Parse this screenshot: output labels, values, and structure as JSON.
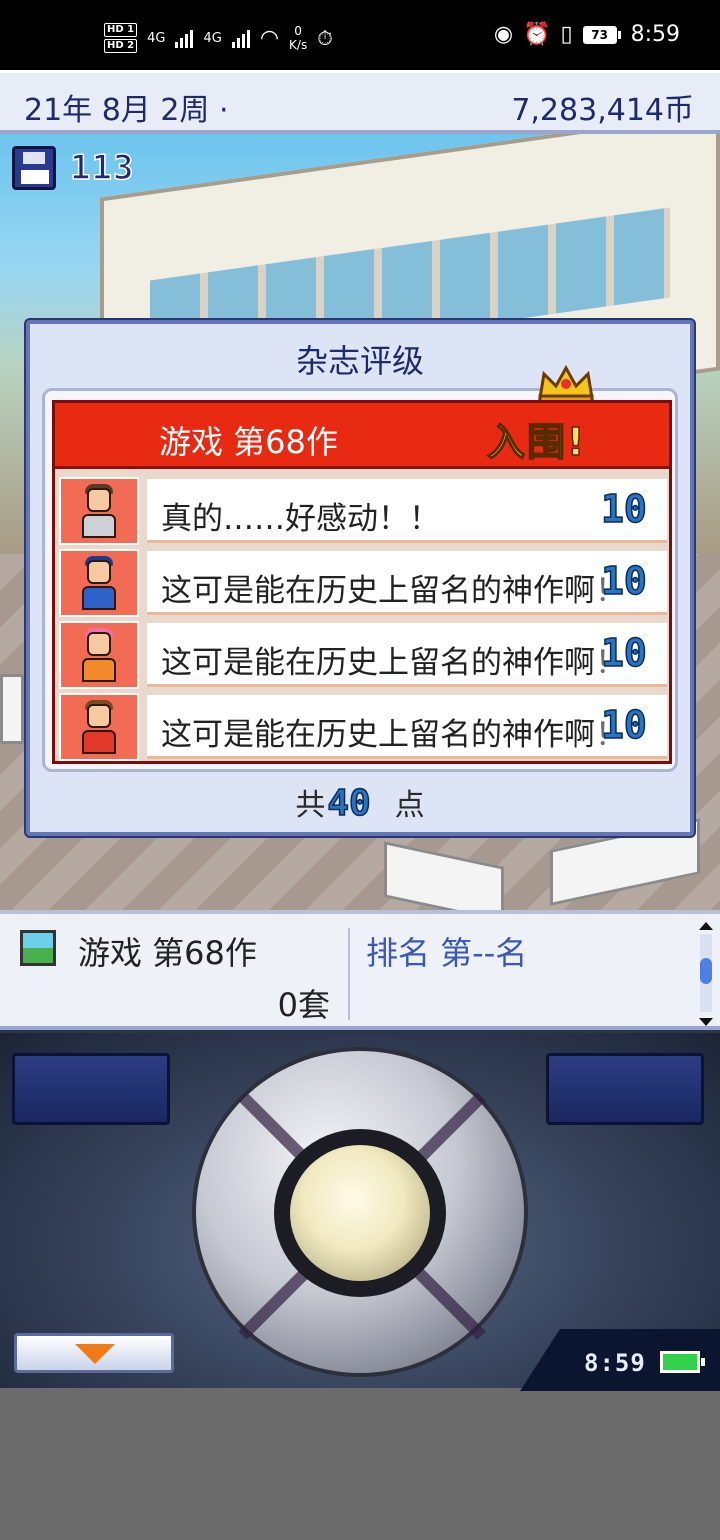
{
  "status_bar": {
    "hd1": "HD 1",
    "hd2": "HD 2",
    "net1": "4G",
    "net2": "4G",
    "speed_value": "0",
    "speed_unit": "K/s",
    "battery": "73",
    "time": "8:59"
  },
  "top_bar": {
    "date": "21年 8月 2周 ·",
    "money": "7,283,414币"
  },
  "save": {
    "count": "113"
  },
  "dialog": {
    "title": "杂志评级",
    "game_name": "游戏 第68作",
    "result": "入围!",
    "reviews": [
      {
        "comment": "真的……好感动！！",
        "score": "10",
        "hair": "#5a3a22",
        "shirt": "#cfcfd8"
      },
      {
        "comment": "这可是能在历史上留名的神作啊！",
        "score": "10",
        "hair": "#1a3d8a",
        "shirt": "#2f62c8"
      },
      {
        "comment": "这可是能在历史上留名的神作啊！",
        "score": "10",
        "hair": "#f070a8",
        "shirt": "#f08a2a"
      },
      {
        "comment": "这可是能在历史上留名的神作啊！",
        "score": "10",
        "hair": "#7a4a22",
        "shirt": "#e23a2a"
      }
    ],
    "total_prefix": "共",
    "total_value": "40",
    "total_suffix": "点"
  },
  "info_panel": {
    "game_name": "游戏 第68作",
    "sales": "0套",
    "rank": "排名 第--名"
  },
  "controller": {
    "clock": "8:59"
  },
  "colors": {
    "accent_red": "#e92a13",
    "score_blue": "#2874c2",
    "panel_navy": "#1e2a6b"
  }
}
